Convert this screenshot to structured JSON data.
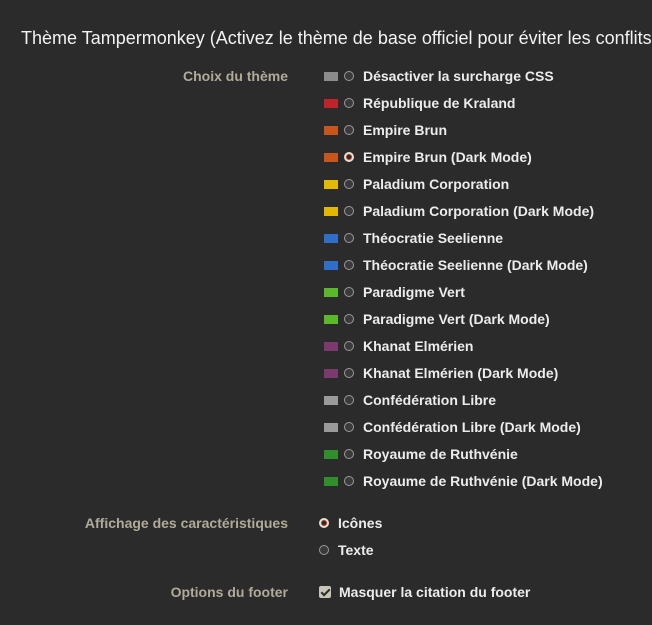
{
  "title": "Thème Tampermonkey (Activez le thème de base officiel pour éviter les conflits",
  "theme_section": {
    "label": "Choix du thème",
    "selected_index": 3,
    "options": [
      {
        "label": "Désactiver la surcharge CSS",
        "flag": "css-flag-icon",
        "color": "#8c8c8c"
      },
      {
        "label": "République de Kraland",
        "flag": "kraland-flag-icon",
        "color": "#c0242a"
      },
      {
        "label": "Empire Brun",
        "flag": "empire-brun-flag-icon",
        "color": "#c8561c"
      },
      {
        "label": "Empire Brun (Dark Mode)",
        "flag": "empire-brun-flag-icon",
        "color": "#c8561c"
      },
      {
        "label": "Paladium Corporation",
        "flag": "paladium-flag-icon",
        "color": "#e3b800"
      },
      {
        "label": "Paladium Corporation (Dark Mode)",
        "flag": "paladium-flag-icon",
        "color": "#e3b800"
      },
      {
        "label": "Théocratie Seelienne",
        "flag": "seelienne-flag-icon",
        "color": "#2f6fc9"
      },
      {
        "label": "Théocratie Seelienne (Dark Mode)",
        "flag": "seelienne-flag-icon",
        "color": "#2f6fc9"
      },
      {
        "label": "Paradigme Vert",
        "flag": "paradigme-vert-flag-icon",
        "color": "#5ab82a"
      },
      {
        "label": "Paradigme Vert (Dark Mode)",
        "flag": "paradigme-vert-flag-icon",
        "color": "#5ab82a"
      },
      {
        "label": "Khanat Elmérien",
        "flag": "khanat-flag-icon",
        "color": "#7a3a6e"
      },
      {
        "label": "Khanat Elmérien (Dark Mode)",
        "flag": "khanat-flag-icon",
        "color": "#7a3a6e"
      },
      {
        "label": "Confédération Libre",
        "flag": "confederation-flag-icon",
        "color": "#9a9a9a"
      },
      {
        "label": "Confédération Libre (Dark Mode)",
        "flag": "confederation-flag-icon",
        "color": "#9a9a9a"
      },
      {
        "label": "Royaume de Ruthvénie",
        "flag": "ruthvenie-flag-icon",
        "color": "#2f8f2a"
      },
      {
        "label": "Royaume de Ruthvénie (Dark Mode)",
        "flag": "ruthvenie-flag-icon",
        "color": "#2f8f2a"
      }
    ]
  },
  "display_section": {
    "label": "Affichage des caractéristiques",
    "selected_index": 0,
    "options": [
      {
        "label": "Icônes"
      },
      {
        "label": "Texte"
      }
    ]
  },
  "footer_section": {
    "label": "Options du footer",
    "checkbox_label": "Masquer la citation du footer",
    "checked": true
  },
  "colors": {
    "background": "#2b2b2b",
    "section_label": "#b0aa99",
    "text": "#ececec"
  }
}
